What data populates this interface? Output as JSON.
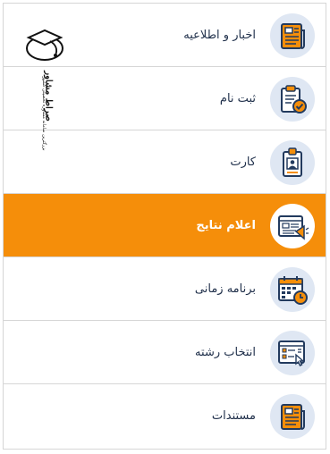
{
  "menu": {
    "items": [
      {
        "label": "اخبار و اطلاعیه",
        "icon": "newspaper-icon",
        "active": false
      },
      {
        "label": "ثبت نام",
        "icon": "clipboard-check-icon",
        "active": false
      },
      {
        "label": "کارت",
        "icon": "id-card-icon",
        "active": false
      },
      {
        "label": "اعلام نتایج",
        "icon": "announcement-icon",
        "active": true
      },
      {
        "label": "برنامه زمانی",
        "icon": "calendar-clock-icon",
        "active": false
      },
      {
        "label": "انتخاب رشته",
        "icon": "selection-list-icon",
        "active": false
      },
      {
        "label": "مستندات",
        "icon": "document-icon",
        "active": false
      }
    ]
  },
  "watermark": {
    "title": "صراط مشاور",
    "subtitle": "بزرگترین سامانه مشاوره تحصیلی کشور"
  },
  "colors": {
    "accent": "#f58e0a",
    "icon_circle": "#dfe7f3",
    "icon_dark": "#223a5e",
    "icon_orange": "#f58e0a",
    "text": "#1f2f4a",
    "border": "#d6d6d6"
  }
}
